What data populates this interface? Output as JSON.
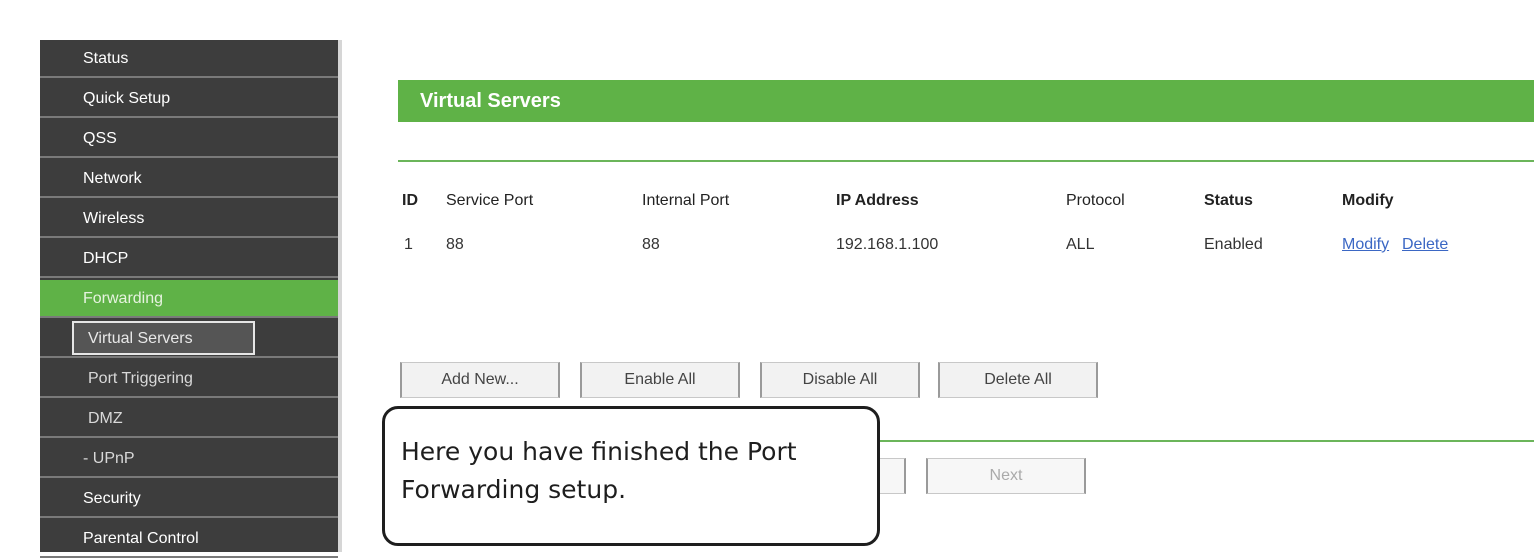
{
  "sidebar": {
    "items": [
      {
        "label": "Status"
      },
      {
        "label": "Quick Setup"
      },
      {
        "label": "QSS"
      },
      {
        "label": "Network"
      },
      {
        "label": "Wireless"
      },
      {
        "label": "DHCP"
      },
      {
        "label": "Forwarding",
        "active": true
      },
      {
        "label": "Virtual Servers",
        "selected": true
      },
      {
        "label": "Port Triggering"
      },
      {
        "label": "DMZ"
      },
      {
        "label": "- UPnP"
      },
      {
        "label": "Security"
      },
      {
        "label": "Parental Control"
      }
    ]
  },
  "main": {
    "title": "Virtual Servers",
    "table": {
      "headers": [
        "ID",
        "Service Port",
        "Internal Port",
        "IP Address",
        "Protocol",
        "Status",
        "Modify"
      ],
      "rows": [
        {
          "id": "1",
          "service_port": "88",
          "internal_port": "88",
          "ip_address": "192.168.1.100",
          "protocol": "ALL",
          "status": "Enabled",
          "modify_link": "Modify",
          "delete_link": "Delete"
        }
      ]
    },
    "buttons": {
      "add_new": "Add New...",
      "enable_all": "Enable All",
      "disable_all": "Disable All",
      "delete_all": "Delete All",
      "next": "Next"
    }
  },
  "callout": {
    "text": "Here you have finished the Port Forwarding setup."
  },
  "colors": {
    "accent_green": "#5fb247",
    "sidebar_bg": "#3d3d3d",
    "link_blue": "#3b67c4"
  }
}
